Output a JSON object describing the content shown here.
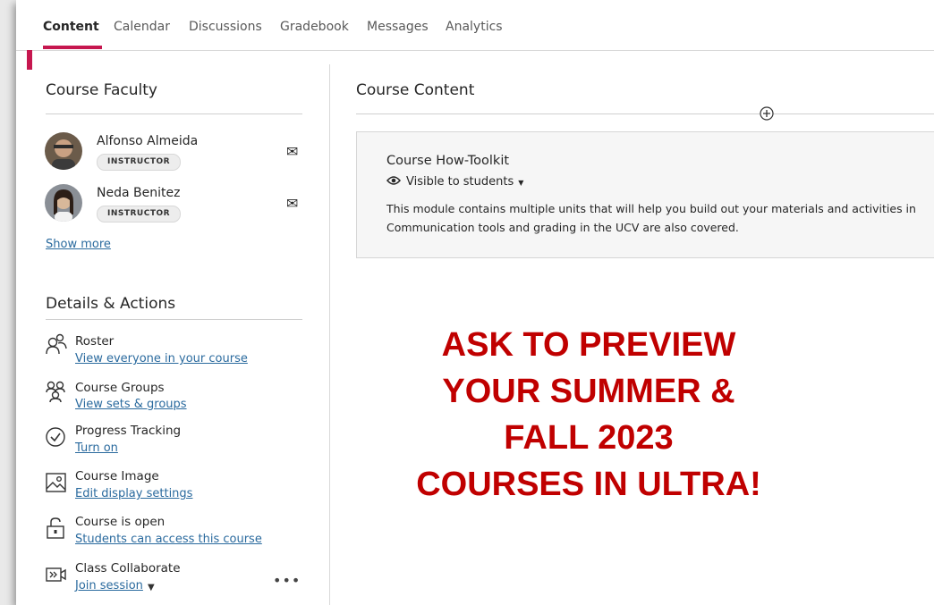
{
  "nav": {
    "tabs": [
      "Content",
      "Calendar",
      "Discussions",
      "Gradebook",
      "Messages",
      "Analytics"
    ],
    "active_tab": "Content"
  },
  "faculty": {
    "heading": "Course Faculty",
    "members": [
      {
        "name": "Alfonso Almeida",
        "role": "INSTRUCTOR"
      },
      {
        "name": "Neda Benitez",
        "role": "INSTRUCTOR"
      }
    ],
    "show_more": "Show more"
  },
  "details": {
    "heading": "Details & Actions",
    "items": [
      {
        "title": "Roster",
        "link": "View everyone in your course",
        "icon": "roster-icon"
      },
      {
        "title": "Course Groups",
        "link": "View sets & groups",
        "icon": "groups-icon"
      },
      {
        "title": "Progress Tracking",
        "link": "Turn on",
        "icon": "check-circle-icon"
      },
      {
        "title": "Course Image",
        "link": "Edit display settings",
        "icon": "image-icon"
      },
      {
        "title": "Course is open",
        "link": "Students can access this course",
        "icon": "unlock-icon"
      },
      {
        "title": "Class Collaborate",
        "link": "Join session",
        "icon": "collaborate-icon"
      }
    ]
  },
  "content": {
    "heading": "Course Content",
    "module": {
      "title": "Course How-Toolkit",
      "visibility": "Visible to students",
      "description": "This module contains multiple units that will help you build out your materials and activities in Communication tools and grading in the UCV are also covered."
    }
  },
  "promo": {
    "lines": [
      "ASK TO PREVIEW",
      "YOUR SUMMER &",
      "FALL 2023",
      "COURSES IN ULTRA!"
    ]
  },
  "colors": {
    "accent": "#c6174f",
    "link": "#2a6a9e",
    "promo": "#c00000"
  }
}
